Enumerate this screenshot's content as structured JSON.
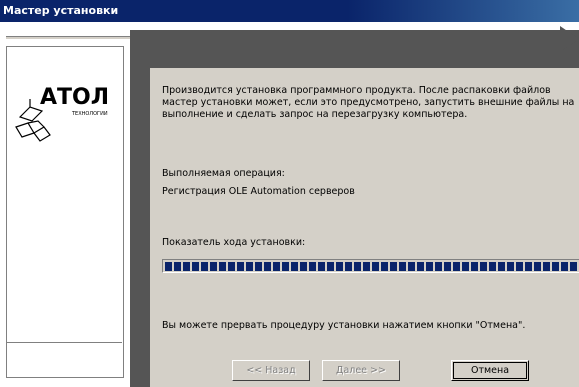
{
  "window": {
    "title": "Мастер установки"
  },
  "logo": {
    "brand": "АТОЛ",
    "sub": "ТЕХНОЛОГИИ"
  },
  "description": "Производится установка программного продукта. После распаковки файлов мастер установки может, если это предусмотрено, запустить внешние файлы на выполнение и сделать запрос на перезагрузку компьютера.",
  "operation": {
    "label": "Выполняемая операция:",
    "value": "Регистрация OLE Automation серверов"
  },
  "progress": {
    "label": "Показатель хода установки:",
    "fraction": 1.0
  },
  "cancel_hint": "Вы можете прервать процедуру установки нажатием кнопки \"Отмена\".",
  "buttons": {
    "back": "<< Назад",
    "next": "Далее >>",
    "cancel": "Отмена"
  },
  "colors": {
    "title_bar": "#0a246a",
    "progress_block": "#0a246a",
    "dialog_face": "#d4d0c8"
  }
}
